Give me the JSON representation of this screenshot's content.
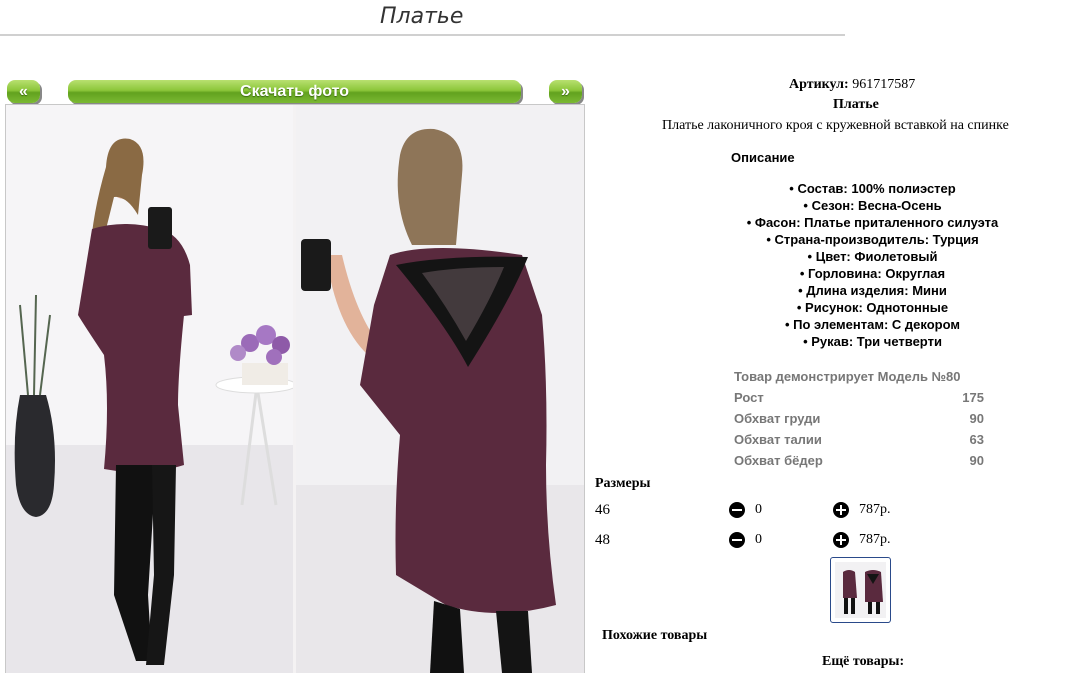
{
  "page": {
    "title": "Платье"
  },
  "gallery": {
    "prev_label": "«",
    "download_label": "Скачать фото",
    "next_label": "»"
  },
  "product": {
    "article_label": "Артикул:",
    "article_value": "961717587",
    "name": "Платье",
    "short_description": "Платье лаконичного кроя с кружевной вставкой на спинке",
    "description_heading": "Описание",
    "properties": [
      "• Состав: 100% полиэстер",
      "• Сезон: Весна-Осень",
      "• Фасон: Платье приталенного силуэта",
      "• Страна-производитель: Турция",
      "• Цвет: Фиолетовый",
      "• Горловина: Округлая",
      "• Длина изделия: Мини",
      "• Рисунок: Однотонные",
      "• По элементам: С декором",
      "• Рукав: Три четверти"
    ],
    "model_params": [
      {
        "label": "Товар демонстрирует Модель №80",
        "value": ""
      },
      {
        "label": "Рост",
        "value": "175"
      },
      {
        "label": "Обхват груди",
        "value": "90"
      },
      {
        "label": "Обхват талии",
        "value": "63"
      },
      {
        "label": "Обхват бёдер",
        "value": "90"
      }
    ]
  },
  "sizes": {
    "heading": "Размеры",
    "rows": [
      {
        "size": "46",
        "qty": "0",
        "price": "787р."
      },
      {
        "size": "48",
        "qty": "0",
        "price": "787р."
      }
    ]
  },
  "related": {
    "similar_label": "Похожие товары",
    "more_label": "Ещё товары:"
  },
  "colors": {
    "dress": "#5a2a3e",
    "accent_green": "#7bb932"
  }
}
